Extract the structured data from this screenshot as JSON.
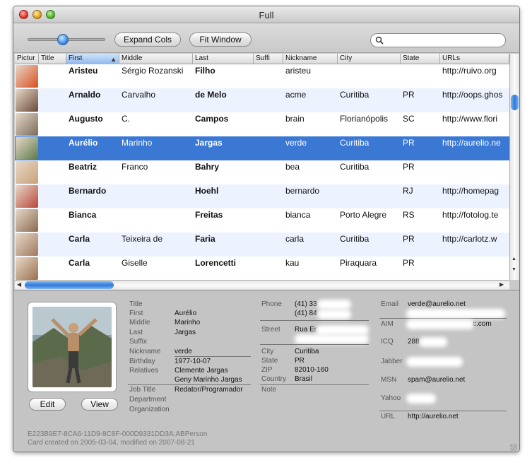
{
  "window": {
    "title": "Full"
  },
  "toolbar": {
    "expand_label": "Expand Cols",
    "fit_label": "Fit Window",
    "search_placeholder": "",
    "zoom_level": 0.45
  },
  "table": {
    "columns": [
      "Pictur",
      "Title",
      "First",
      "Middle",
      "Last",
      "Suffi",
      "Nickname",
      "City",
      "State",
      "URLs"
    ],
    "sorted_column": "First",
    "rows": [
      {
        "first": "Aristeu",
        "middle": "Sérgio Rozanski",
        "last": "Filho",
        "nickname": "aristeu",
        "city": "",
        "state": "",
        "url": "http://ruivo.org",
        "photo_color": "#d94f1e"
      },
      {
        "first": "Arnaldo",
        "middle": "Carvalho",
        "last": "de Melo",
        "nickname": "acme",
        "city": "Curitiba",
        "state": "PR",
        "url": "http://oops.ghos",
        "photo_color": "#6b4a3a"
      },
      {
        "first": "Augusto",
        "middle": "C.",
        "last": "Campos",
        "nickname": "brain",
        "city": "Florianópolis",
        "state": "SC",
        "url": "http://www.flori",
        "photo_color": "#7a6a5a"
      },
      {
        "first": "Aurélio",
        "middle": "Marinho",
        "last": "Jargas",
        "nickname": "verde",
        "city": "Curitiba",
        "state": "PR",
        "url": "http://aurelio.ne",
        "photo_color": "#5a7a4a"
      },
      {
        "first": "Beatriz",
        "middle": "Franco",
        "last": "Bahry",
        "nickname": "bea",
        "city": "Curitiba",
        "state": "PR",
        "url": "",
        "photo_color": "#c9a27a"
      },
      {
        "first": "Bernardo",
        "middle": "",
        "last": "Hoehl",
        "nickname": "bernardo",
        "city": "",
        "state": "RJ",
        "url": "http://homepag",
        "photo_color": "#b8463a"
      },
      {
        "first": "Bianca",
        "middle": "",
        "last": "Freitas",
        "nickname": "bianca",
        "city": "Porto Alegre",
        "state": "RS",
        "url": "http://fotolog.te",
        "photo_color": "#8a6a50"
      },
      {
        "first": "Carla",
        "middle": "Teixeira de",
        "last": "Faria",
        "nickname": "carla",
        "city": "Curitiba",
        "state": "PR",
        "url": "http://carlotz.w",
        "photo_color": "#a07a60"
      },
      {
        "first": "Carla",
        "middle": "Giselle",
        "last": "Lorencetti",
        "nickname": "kau",
        "city": "Piraquara",
        "state": "PR",
        "url": "",
        "photo_color": "#9a7050"
      }
    ],
    "selected_index": 3
  },
  "card": {
    "labels": {
      "title": "Title",
      "first": "First",
      "middle": "Middle",
      "last": "Last",
      "suffix": "Suffix",
      "nickname": "Nickname",
      "birthday": "Birthday",
      "relatives": "Relatives",
      "job_title": "Job Title",
      "department": "Department",
      "organization": "Organization",
      "phone": "Phone",
      "street": "Street",
      "city": "City",
      "state": "State",
      "zip": "ZIP",
      "country": "Country",
      "note": "Note",
      "email": "Email",
      "aim": "AIM",
      "icq": "ICQ",
      "jabber": "Jabber",
      "msn": "MSN",
      "yahoo": "Yahoo",
      "url": "URL"
    },
    "values": {
      "first": "Aurélio",
      "middle": "Marinho",
      "last": "Jargas",
      "nickname": "verde",
      "birthday": "1977-10-07",
      "relative1": "Clemente Jargas",
      "relative2": "Geny Marinho Jargas",
      "job_title": "Redator/Programador",
      "phone1": "(41) 33",
      "phone2": "(41) 84",
      "street": "Rua Er",
      "city": "Curitiba",
      "state": "PR",
      "zip": "82010-160",
      "country": "Brasil",
      "email": "verde@aurelio.net",
      "aim_suffix": "c.com",
      "icq": "288",
      "msn": "spam@aurelio.net",
      "url": "http://aurelio.net"
    },
    "buttons": {
      "edit": "Edit",
      "view": "View"
    },
    "footer": {
      "uid": "E223B9E7-8CA6-11D9-8C8F-000D9331DD3A:ABPerson",
      "created": "Card created on 2005-03-04, modified on 2007-08-21"
    }
  }
}
